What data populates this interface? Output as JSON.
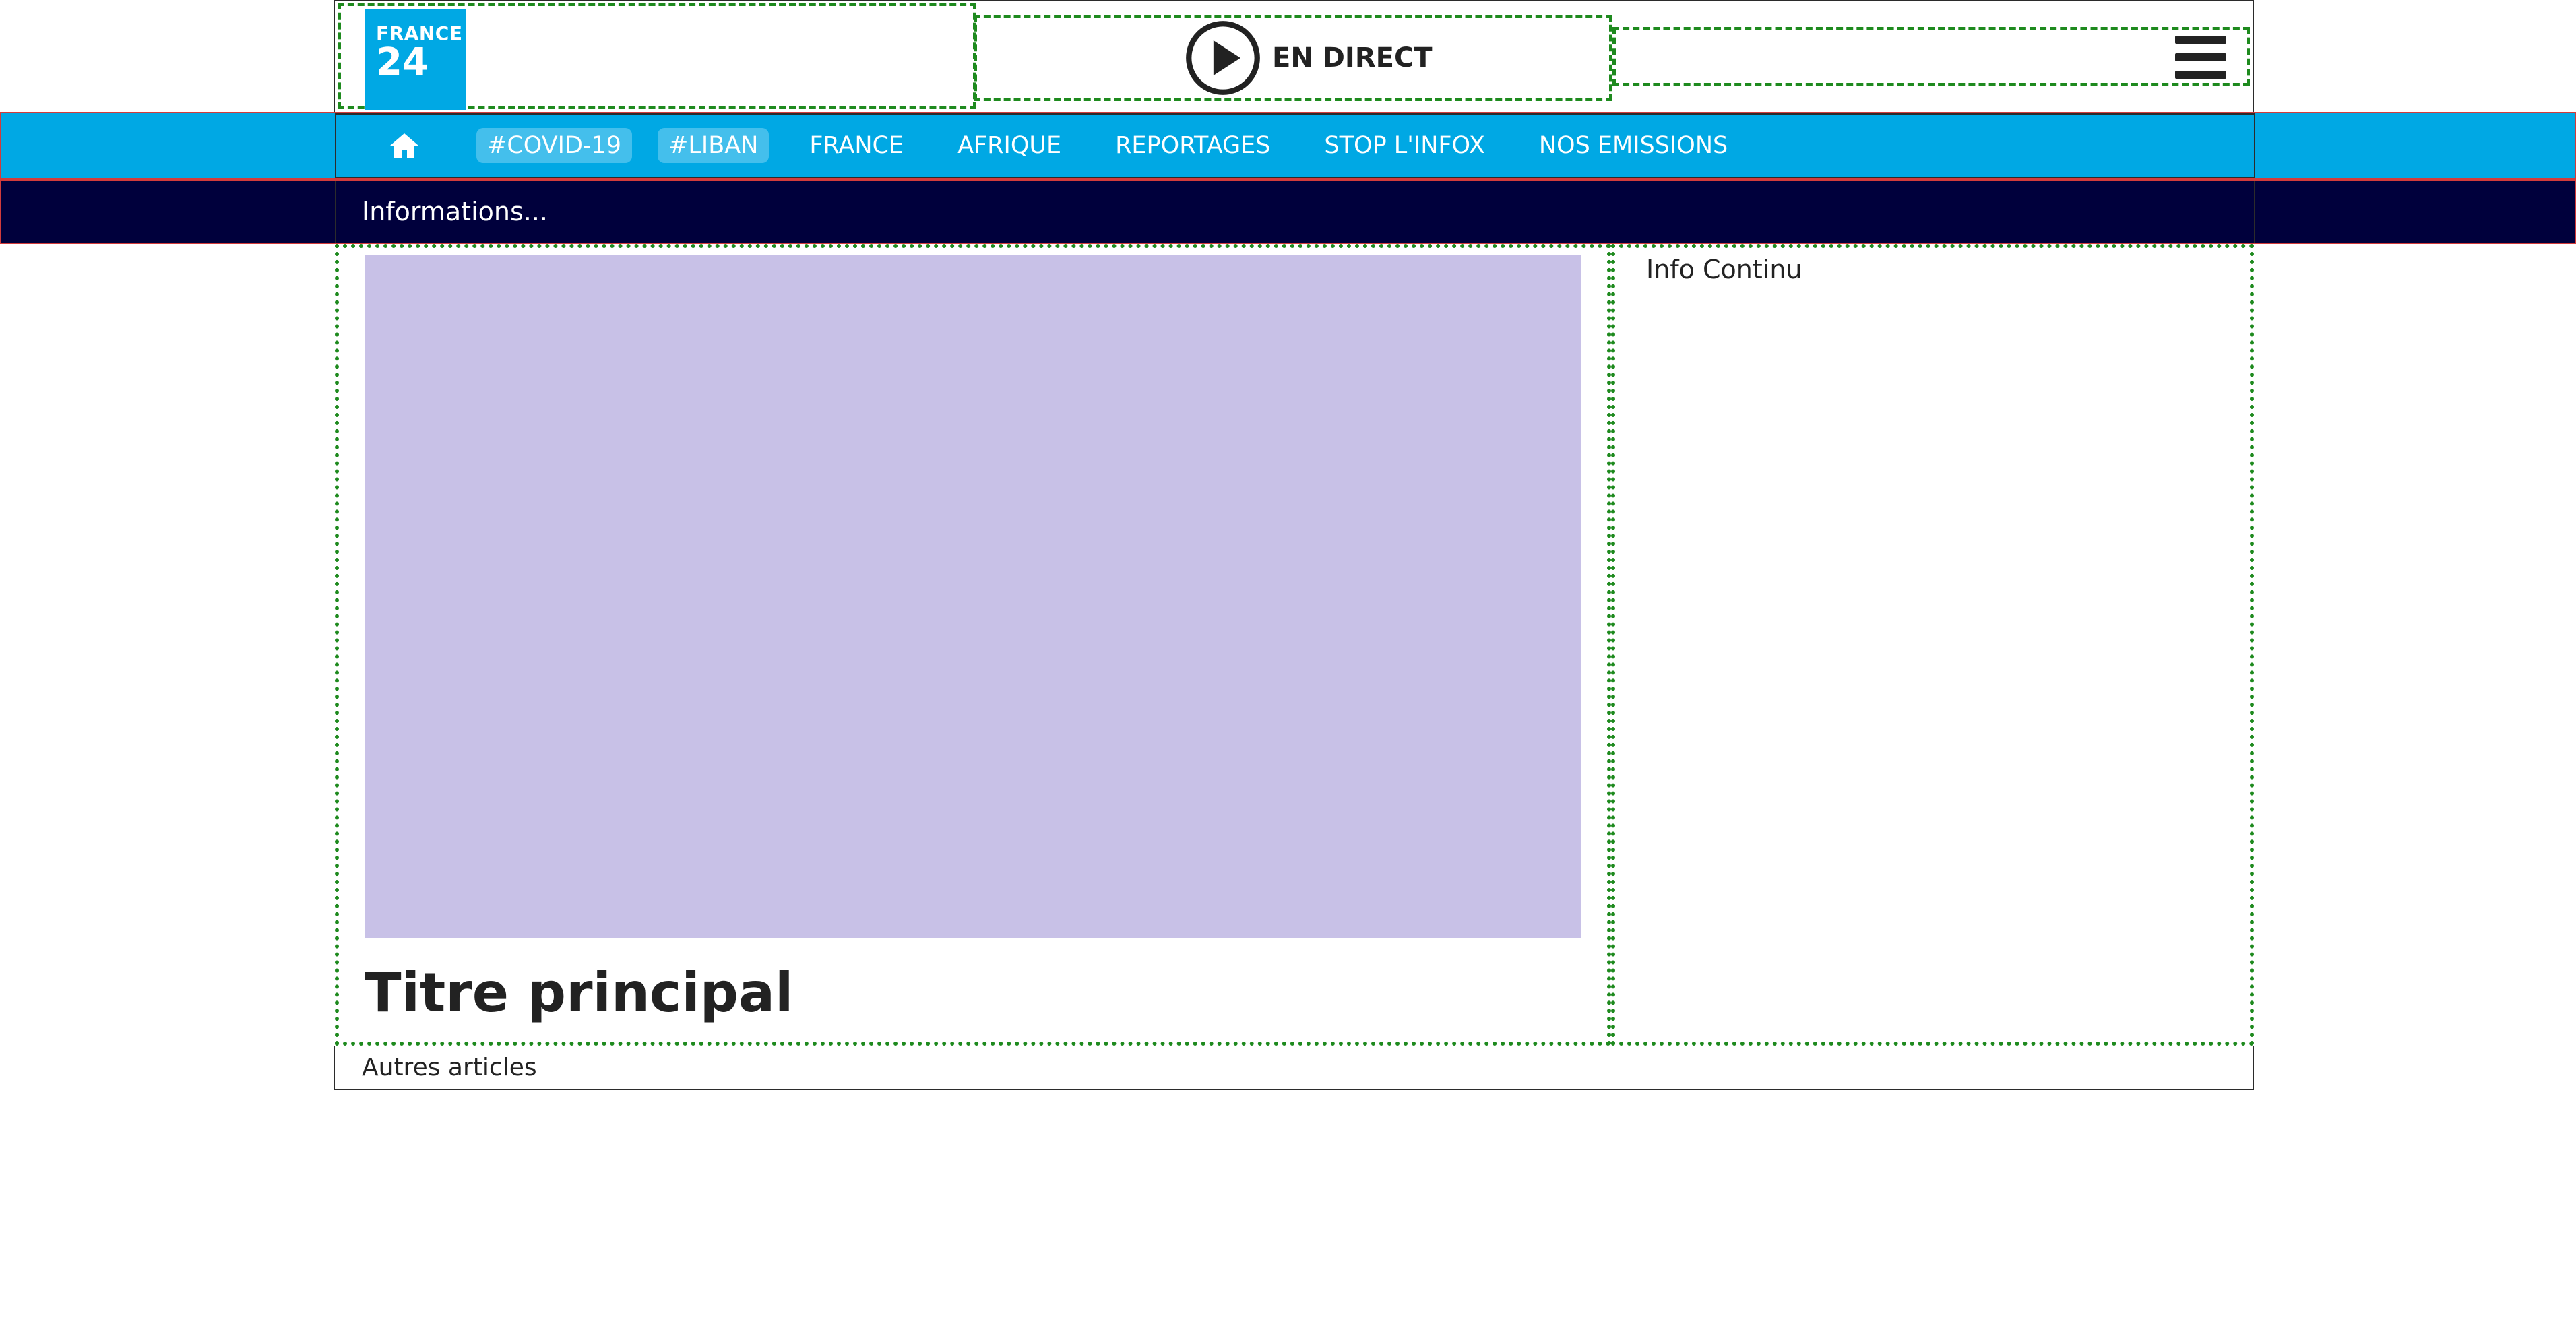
{
  "header": {
    "logo": {
      "line1": "FRANCE",
      "line2": "24",
      "color": "#00a8e4"
    },
    "live": {
      "label": "EN DIRECT",
      "icon": "play-circle-icon"
    },
    "menu_icon": "hamburger-menu-icon"
  },
  "nav": {
    "home_icon": "home-icon",
    "bg_color": "#00a8e4",
    "items": [
      {
        "label": "#COVID-19",
        "highlighted": true
      },
      {
        "label": "#LIBAN",
        "highlighted": true
      },
      {
        "label": "FRANCE",
        "highlighted": false
      },
      {
        "label": "AFRIQUE",
        "highlighted": false
      },
      {
        "label": "REPORTAGES",
        "highlighted": false
      },
      {
        "label": "STOP L'INFOX",
        "highlighted": false
      },
      {
        "label": "NOS EMISSIONS",
        "highlighted": false
      }
    ]
  },
  "ticker": {
    "text": "Informations...",
    "bg_color": "#00003c"
  },
  "main": {
    "headline": "Titre principal",
    "hero_color": "#c8c1e7"
  },
  "sidebar": {
    "title": "Info Continu"
  },
  "footer": {
    "others_label": "Autres articles"
  }
}
